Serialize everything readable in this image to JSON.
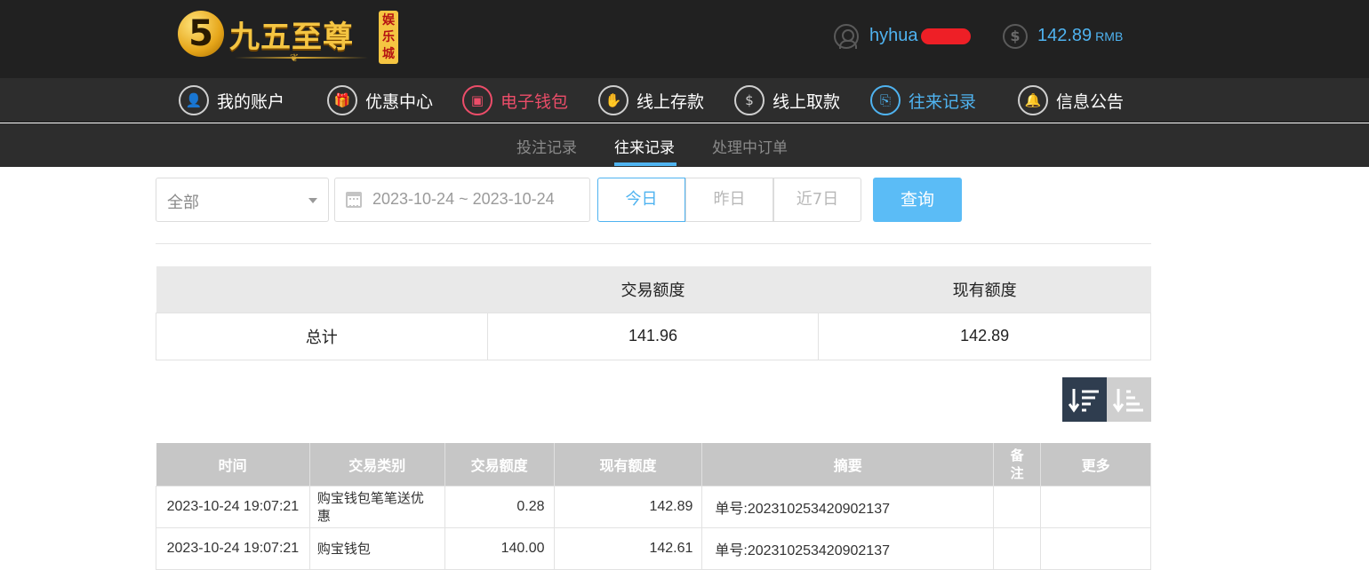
{
  "header": {
    "logo_title": "九五至尊",
    "logo_badge": [
      "娱",
      "乐",
      "城"
    ],
    "logo_mark": "5",
    "username": "hyhua",
    "balance": "142.89",
    "currency": "RMB"
  },
  "main_nav": {
    "items": [
      {
        "label": "我的账户",
        "icon": "user-icon"
      },
      {
        "label": "优惠中心",
        "icon": "gift-icon"
      },
      {
        "label": "电子钱包",
        "icon": "wallet-icon"
      },
      {
        "label": "线上存款",
        "icon": "deposit-icon"
      },
      {
        "label": "线上取款",
        "icon": "withdraw-icon"
      },
      {
        "label": "往来记录",
        "icon": "records-icon"
      },
      {
        "label": "信息公告",
        "icon": "bell-icon"
      }
    ],
    "active_label": "往来记录",
    "highlight_label": "电子钱包"
  },
  "sub_nav": {
    "items": [
      "投注记录",
      "往来记录",
      "处理中订单"
    ],
    "active": "往来记录"
  },
  "filters": {
    "type_select": "全部",
    "date_range": "2023-10-24 ~ 2023-10-24",
    "range_buttons": [
      "今日",
      "昨日",
      "近7日"
    ],
    "active_range": "今日",
    "query_label": "查询"
  },
  "summary": {
    "headers": [
      "",
      "交易额度",
      "现有额度"
    ],
    "row_label": "总计",
    "transaction_total": "141.96",
    "current_total": "142.89"
  },
  "records": {
    "headers": [
      "时间",
      "交易类别",
      "交易额度",
      "现有额度",
      "摘要",
      "备注",
      "更多"
    ],
    "rows": [
      {
        "time": "2023-10-24 19:07:21",
        "category": "购宝钱包笔笔送优惠",
        "amount": "0.28",
        "balance": "142.89",
        "summary": "单号:202310253420902137",
        "note": "",
        "more": ""
      },
      {
        "time": "2023-10-24 19:07:21",
        "category": "购宝钱包",
        "amount": "140.00",
        "balance": "142.61",
        "summary": "单号:202310253420902137",
        "note": "",
        "more": ""
      }
    ]
  },
  "colors": {
    "header_bg": "#212121",
    "nav_bg": "#2d2d2d",
    "accent_blue": "#4fb3f0",
    "accent_red": "#ec4d69",
    "query_button": "#5bbcf6",
    "sort_active": "#2f3d4f"
  }
}
